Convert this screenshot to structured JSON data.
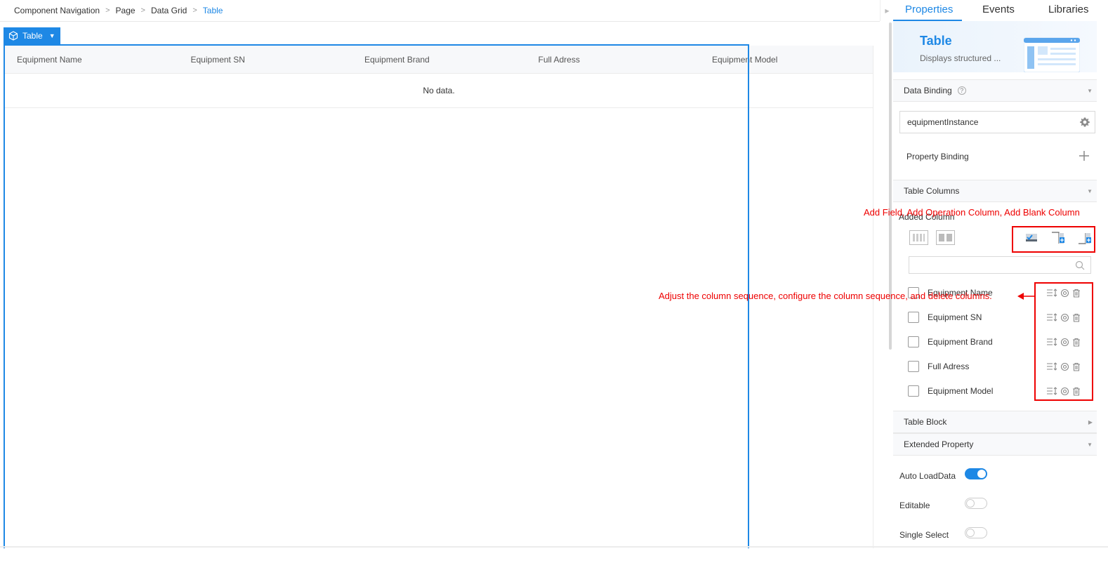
{
  "breadcrumb": {
    "items": [
      "Component Navigation",
      "Page",
      "Data Grid"
    ],
    "current": "Table",
    "separator": ">"
  },
  "component_tag": {
    "label": "Table"
  },
  "grid": {
    "columns": [
      "Equipment Name",
      "Equipment SN",
      "Equipment Brand",
      "Full Adress",
      "Equipment Model"
    ],
    "empty_text": "No data."
  },
  "panel": {
    "tabs": [
      "Properties",
      "Events",
      "Libraries"
    ],
    "active_tab": "Properties",
    "hero": {
      "title": "Table",
      "description": "Displays structured ..."
    },
    "data_binding": {
      "title": "Data Binding",
      "help": "?",
      "value": "equipmentInstance",
      "property_binding": "Property Binding"
    },
    "table_columns": {
      "title": "Table Columns",
      "added_column": "Added Column",
      "search_value": "",
      "rows": [
        "Equipment Name",
        "Equipment SN",
        "Equipment Brand",
        "Full Adress",
        "Equipment Model"
      ]
    },
    "table_block": {
      "title": "Table Block"
    },
    "extended_property": {
      "title": "Extended Property",
      "auto_load_data": {
        "label": "Auto LoadData",
        "on": true
      },
      "editable": {
        "label": "Editable",
        "on": false
      },
      "single_select": {
        "label": "Single Select",
        "on": false
      }
    }
  },
  "annotations": {
    "toolbar_note": "Add Field, Add Operation Column, Add Blank Column",
    "row_actions_note": "Adjust the column sequence, configure the column sequence, and delete columns."
  },
  "colors": {
    "accent": "#1e88e5",
    "annotation": "#e00000"
  }
}
